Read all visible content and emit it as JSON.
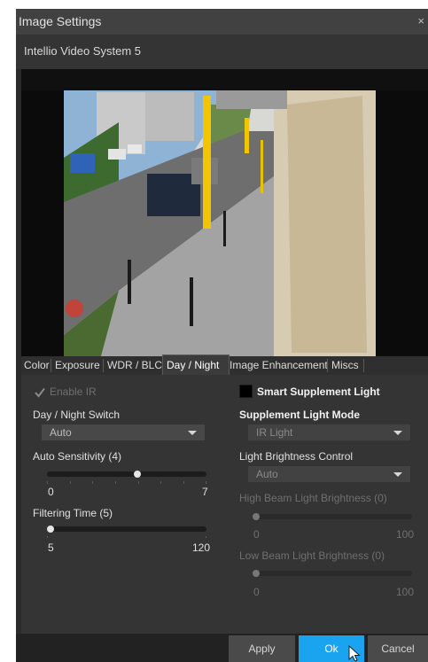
{
  "window": {
    "title": "Image Settings",
    "close_glyph": "×"
  },
  "device": {
    "name": "Intellio Video System 5"
  },
  "tabs": [
    {
      "label": "Color"
    },
    {
      "label": "Exposure"
    },
    {
      "label": "WDR / BLC"
    },
    {
      "label": "Day / Night",
      "active": true
    },
    {
      "label": "Image Enhancement"
    },
    {
      "label": "Miscs"
    }
  ],
  "left": {
    "enable_ir": {
      "label": "Enable IR",
      "checked": true,
      "disabled": true
    },
    "day_night_switch": {
      "label": "Day / Night Switch",
      "value": "Auto"
    },
    "auto_sensitivity": {
      "label": "Auto Sensitivity (4)",
      "min": "0",
      "max": "7",
      "value": 4
    },
    "filtering_time": {
      "label": "Filtering Time (5)",
      "min": "5",
      "max": "120",
      "value": 5
    }
  },
  "right": {
    "smart_supplement": {
      "label": "Smart Supplement Light",
      "checked": false
    },
    "supplement_mode": {
      "label": "Supplement Light Mode",
      "value": "IR Light",
      "disabled": true
    },
    "brightness_control": {
      "label": "Light Brightness Control",
      "value": "Auto"
    },
    "high_beam": {
      "label": "High Beam Light Brightness (0)",
      "min": "0",
      "max": "100",
      "value": 0
    },
    "low_beam": {
      "label": "Low Beam Light Brightness (0)",
      "min": "0",
      "max": "100",
      "value": 0
    }
  },
  "buttons": {
    "apply": "Apply",
    "ok": "Ok",
    "cancel": "Cancel"
  },
  "colors": {
    "accent": "#1aa3ee",
    "panel": "#343434",
    "titlebar": "#414141"
  }
}
